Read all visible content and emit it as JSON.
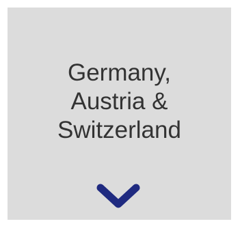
{
  "region_tile": {
    "label_lines": [
      "Germany,",
      "Austria &",
      "Switzerland"
    ],
    "background_color": "#dcdcdc",
    "text_color": "#333333",
    "chevron_icon": "chevron-down-icon",
    "chevron_color": "#1f2a80"
  }
}
